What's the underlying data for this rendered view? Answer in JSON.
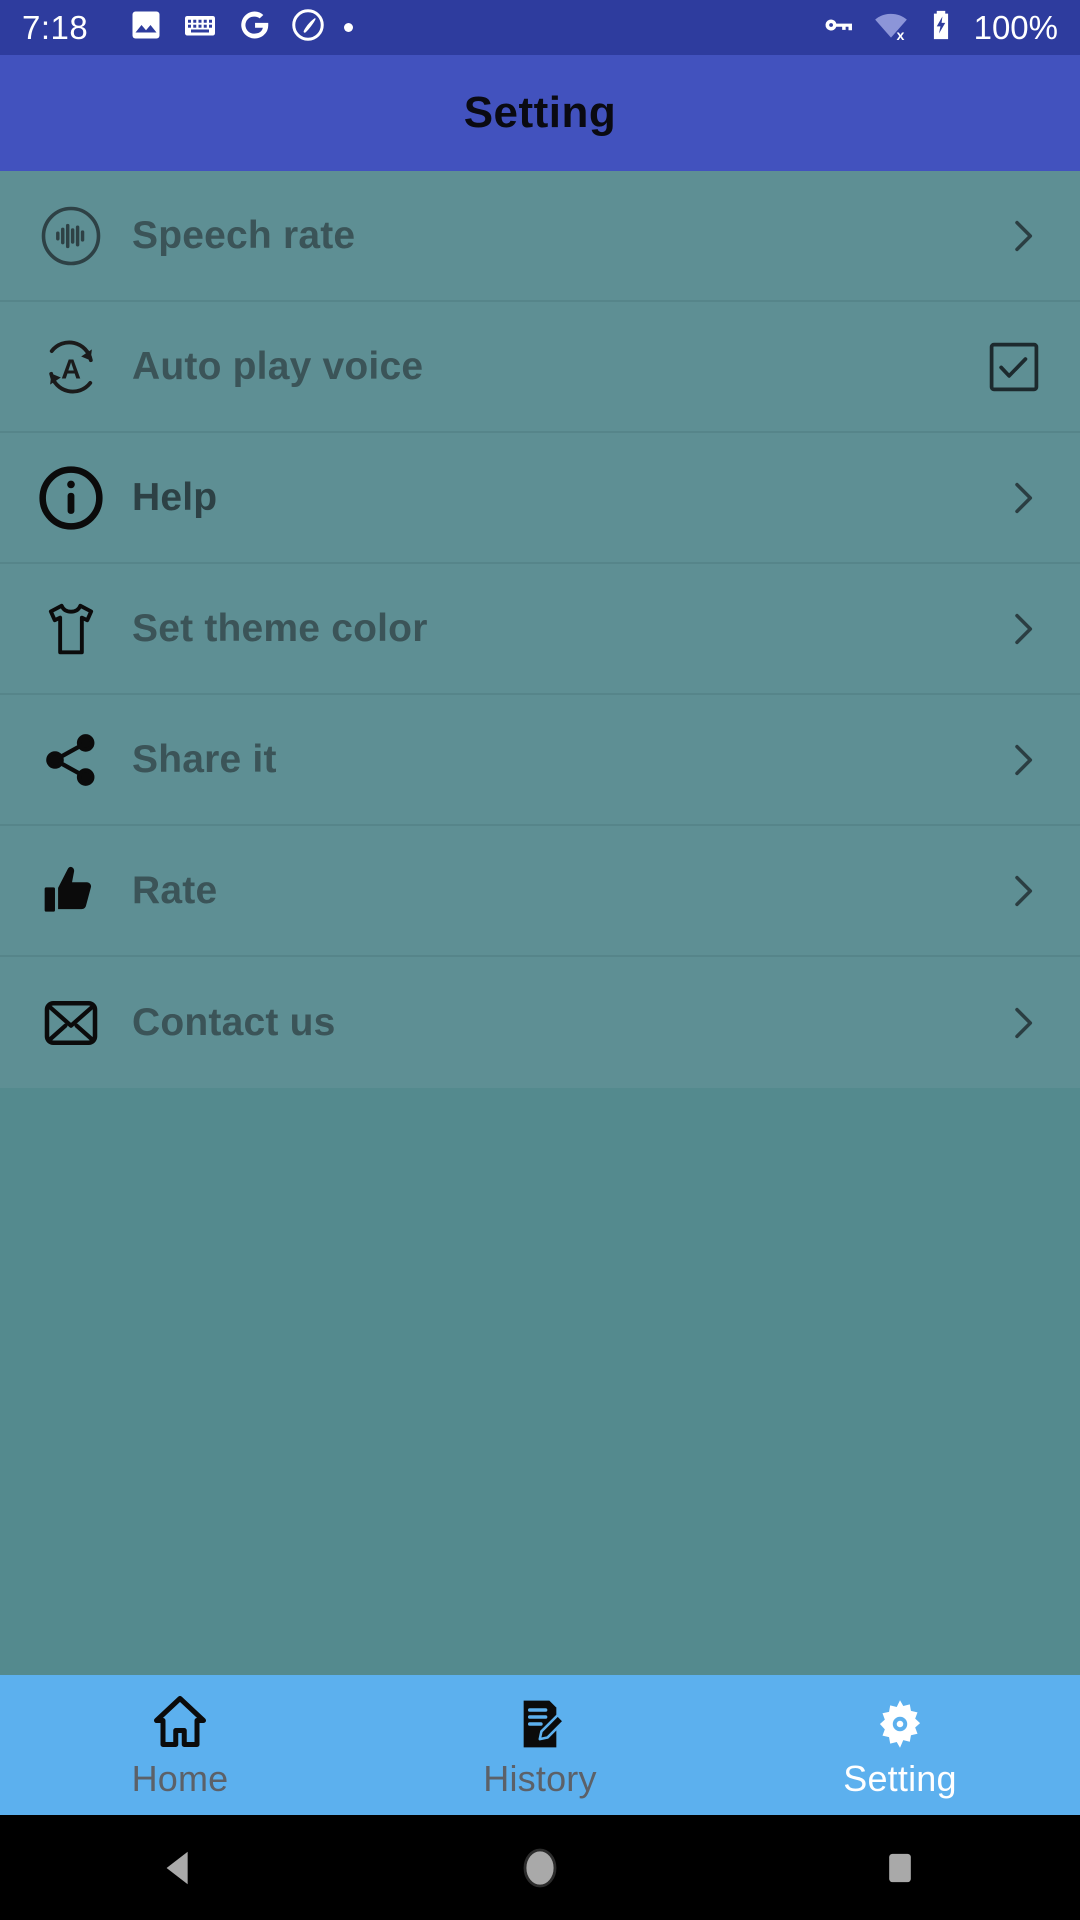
{
  "status_bar": {
    "time": "7:18",
    "battery_text": "100%",
    "left_icons": [
      "photo-icon",
      "keyboard-icon",
      "google-icon",
      "capture-icon",
      "dot-indicator-icon"
    ],
    "right_icons": [
      "vpn-key-icon",
      "wifi-off-icon",
      "battery-charging-icon"
    ],
    "background": "#2e3c9e"
  },
  "header": {
    "title": "Setting",
    "background": "#4252be",
    "title_color": "#0a0a12"
  },
  "theme": {
    "content_background": "#548a8e",
    "row_background": "#5e8f94",
    "divider": "#56858a",
    "label_color": "#3b5458",
    "bottom_nav_background": "#5cb0ee",
    "bottom_nav_active": "#ffffff",
    "bottom_nav_inactive": "#5c6168"
  },
  "settings_list": [
    {
      "label": "Speech rate",
      "icon": "speech-waveform-icon",
      "accessory": "chevron-right-icon",
      "emphasis": "normal"
    },
    {
      "label": "Auto play voice",
      "icon": "auto-rotate-a-icon",
      "accessory": "checkbox",
      "checked": true,
      "emphasis": "normal"
    },
    {
      "label": "Help",
      "icon": "info-circle-icon",
      "accessory": "chevron-right-icon",
      "emphasis": "strong"
    },
    {
      "label": "Set theme color",
      "icon": "tshirt-icon",
      "accessory": "chevron-right-icon",
      "emphasis": "normal"
    },
    {
      "label": "Share it",
      "icon": "share-icon",
      "accessory": "chevron-right-icon",
      "emphasis": "normal"
    },
    {
      "label": "Rate",
      "icon": "thumbs-up-icon",
      "accessory": "chevron-right-icon",
      "emphasis": "normal"
    },
    {
      "label": "Contact us",
      "icon": "envelope-icon",
      "accessory": "chevron-right-icon",
      "emphasis": "normal"
    }
  ],
  "bottom_nav": {
    "items": [
      {
        "label": "Home",
        "icon": "home-icon",
        "active": false
      },
      {
        "label": "History",
        "icon": "history-note-icon",
        "active": false
      },
      {
        "label": "Setting",
        "icon": "gear-icon",
        "active": true
      }
    ]
  },
  "android_nav": {
    "buttons": [
      "back-button",
      "home-button",
      "recents-button"
    ]
  }
}
